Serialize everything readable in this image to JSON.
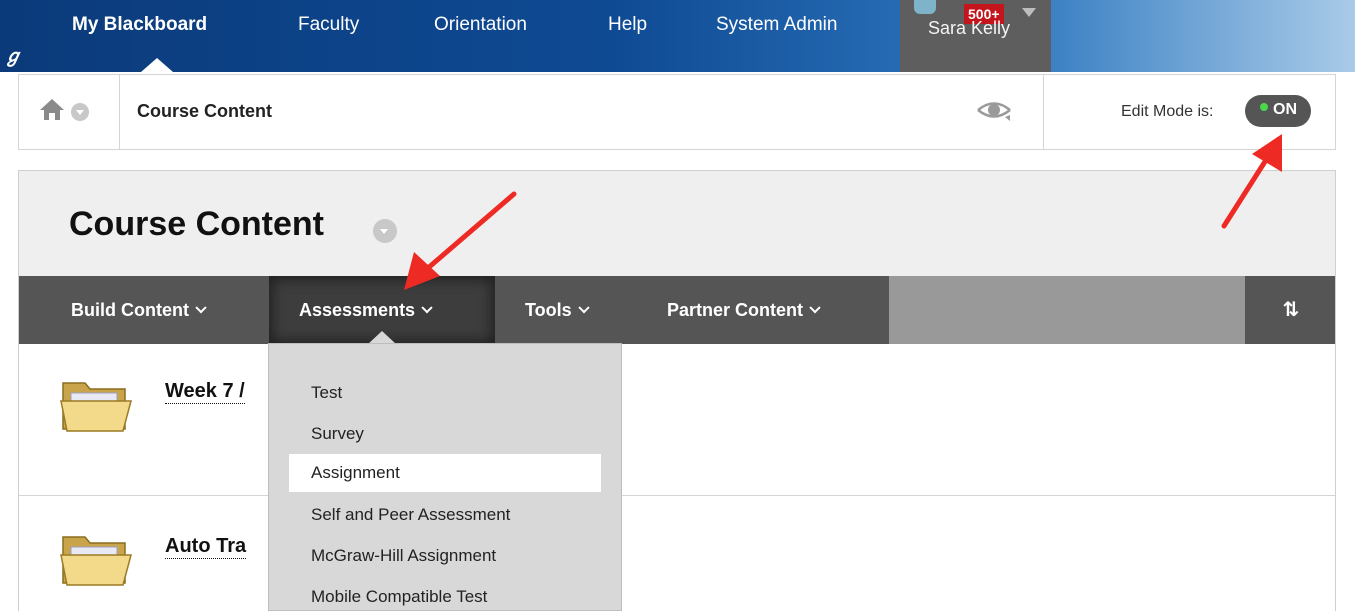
{
  "topnav": {
    "tabs": [
      "My Blackboard",
      "Faculty",
      "Orientation",
      "Help",
      "System Admin"
    ],
    "active_tab": "My Blackboard",
    "user": {
      "name": "Sara Kelly",
      "badge": "500+"
    }
  },
  "breadcrumb": {
    "current": "Course Content"
  },
  "edit_mode": {
    "label": "Edit Mode is:",
    "state": "ON"
  },
  "page": {
    "title": "Course Content"
  },
  "action_bar": {
    "items": [
      "Build Content",
      "Assessments",
      "Tools",
      "Partner Content"
    ],
    "active": "Assessments"
  },
  "content_items": [
    {
      "title": "Week 7 /"
    },
    {
      "title": "Auto Tra"
    }
  ],
  "assessments_menu": {
    "items": [
      "Test",
      "Survey",
      "Assignment",
      "Self and Peer Assessment",
      "McGraw-Hill Assignment",
      "Mobile Compatible Test"
    ],
    "selected": "Assignment"
  },
  "colors": {
    "nav_blue": "#0e4a93",
    "action_bar": "#555555",
    "arrow_red": "#ee2a24",
    "badge_red": "#c4151c",
    "toggle_on": "#4cd84c"
  },
  "icons": [
    "home-icon",
    "eye-icon",
    "folder-icon",
    "sort-icon",
    "chevron-down-icon"
  ]
}
